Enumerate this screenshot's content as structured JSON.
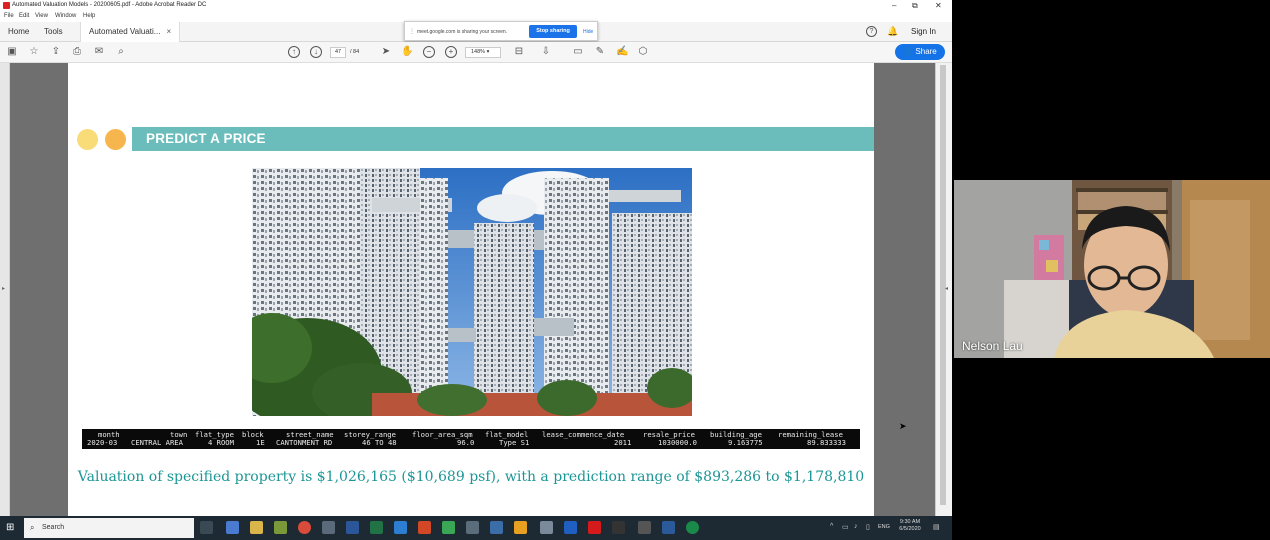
{
  "window": {
    "title": "Automated Valuation Models - 20200605.pdf - Adobe Acrobat Reader DC",
    "controls": [
      "–",
      "⧉",
      "✕"
    ]
  },
  "menu": [
    "File",
    "Edit",
    "View",
    "Window",
    "Help"
  ],
  "tabs": {
    "home": "Home",
    "tools": "Tools",
    "document": "Automated Valuati...",
    "close": "×",
    "sign_in": "Sign In",
    "help": "?"
  },
  "share_notice": {
    "message": "meet.google.com is sharing your screen.",
    "stop": "Stop sharing",
    "hide": "Hide"
  },
  "toolbar": {
    "page_current": "47",
    "page_total": "/ 84",
    "zoom": "148%",
    "share_label": "Share"
  },
  "slide": {
    "banner_title": "PREDICT A PRICE",
    "table": {
      "header": [
        "month",
        "town",
        "flat_type",
        "block",
        "street_name",
        "storey_range",
        "floor_area_sqm",
        "flat_model",
        "lease_commence_date",
        "resale_price",
        "building_age",
        "remaining_lease"
      ],
      "row": [
        "2020-03",
        "CENTRAL AREA",
        "4 ROOM",
        "1E",
        "CANTONMENT RD",
        "46 TO 48",
        "96.0",
        "Type S1",
        "2011",
        "1030000.0",
        "9.163775",
        "89.833333"
      ]
    },
    "valuation_text": "Valuation of specified property is $1,026,165 ($10,689 psf), with a prediction range of $893,286 to $1,178,810"
  },
  "video": {
    "participant_name": "Nelson Lau"
  },
  "taskbar": {
    "search_placeholder": "Search",
    "time": "9:30 AM",
    "date": "6/5/2020",
    "lang": "ENG"
  },
  "colors": {
    "banner": "#6bbdbb",
    "dot_light": "#f9dc78",
    "dot_dark": "#f6b64d",
    "valuation_text": "#1c9695",
    "share_button": "#1473e6"
  }
}
